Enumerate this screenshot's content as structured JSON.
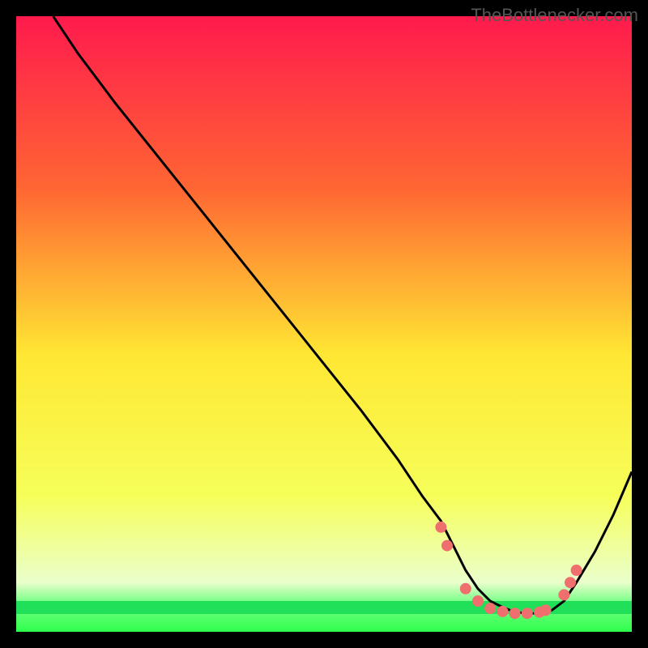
{
  "watermark": "TheBottlenecker.com",
  "chart_data": {
    "type": "line",
    "title": "",
    "xlabel": "",
    "ylabel": "",
    "xlim": [
      0,
      100
    ],
    "ylim": [
      0,
      100
    ],
    "background_gradient": {
      "top": "#ff1a4d",
      "mid_upper": "#ff8c33",
      "mid": "#ffe733",
      "mid_lower": "#f9ff66",
      "green_band": "#2eff4d",
      "bottom": "#2eff4d"
    },
    "curve": {
      "x": [
        6,
        10,
        16,
        24,
        32,
        40,
        48,
        56,
        62,
        66,
        69,
        71,
        73,
        75,
        77,
        79,
        81,
        83,
        85,
        87,
        89,
        91,
        94,
        97,
        100
      ],
      "y_pct": [
        100,
        94,
        86,
        76,
        66,
        56,
        46,
        36,
        28,
        22,
        18,
        14,
        10,
        7,
        5,
        4,
        3.2,
        3,
        3,
        3.5,
        5,
        8,
        13,
        19,
        26
      ]
    },
    "markers": {
      "x": [
        69,
        70,
        73,
        75,
        77,
        79,
        81,
        83,
        85,
        86,
        89,
        90,
        91
      ],
      "y_pct": [
        17,
        14,
        7,
        5,
        3.8,
        3.3,
        3,
        3,
        3.2,
        3.5,
        6,
        8,
        10
      ]
    }
  }
}
